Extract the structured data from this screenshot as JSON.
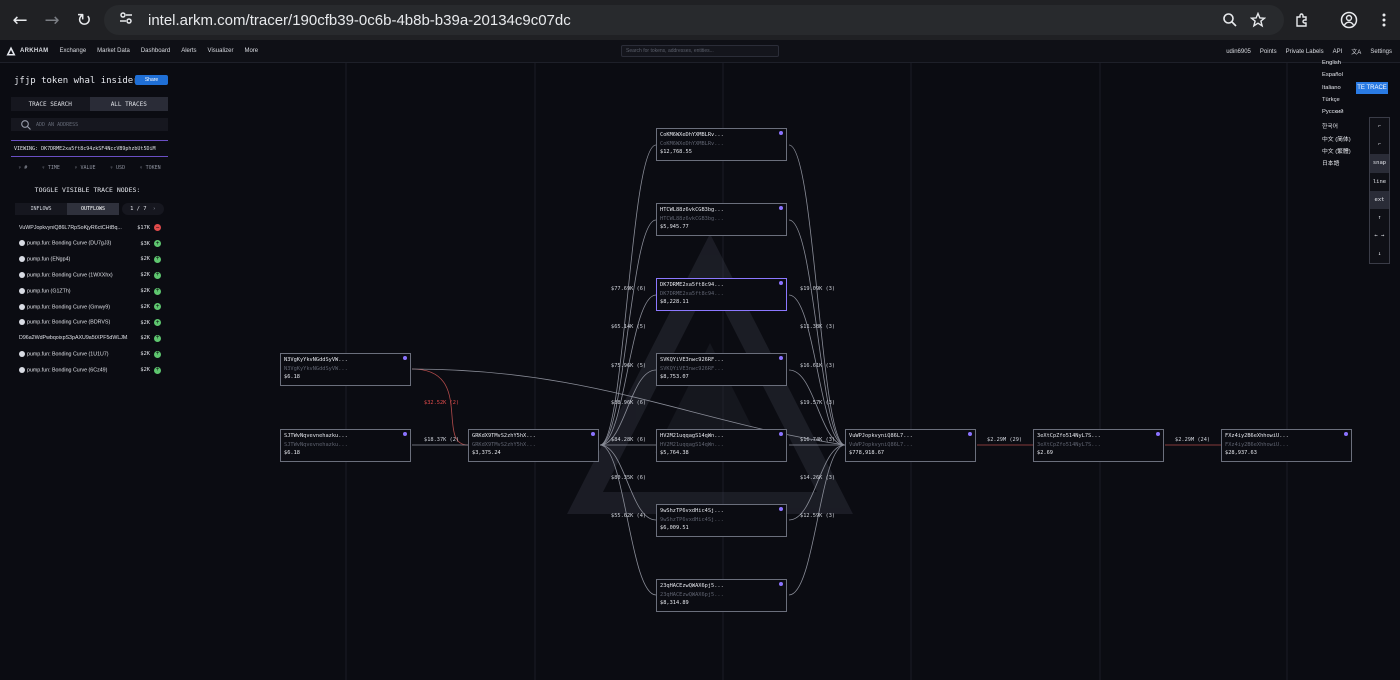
{
  "browser": {
    "url": "intel.arkm.com/tracer/190cfb39-0c6b-4b8b-b39a-20134c9c07dc"
  },
  "nav": {
    "brand": "ARKHAM",
    "links": [
      "Exchange",
      "Market Data",
      "Dashboard",
      "Alerts",
      "Visualizer",
      "More"
    ],
    "search_placeholder": "Search for tokens, addresses, entities...",
    "right": [
      "udin6905",
      "Points",
      "Private Labels",
      "API",
      "Settings"
    ]
  },
  "sidebar": {
    "title": "jfjp token whal insider",
    "share": "Share",
    "tab_search": "TRACE SEARCH",
    "tab_all": "ALL TRACES",
    "address_placeholder": "ADD AN ADDRESS",
    "viewing": "VIEWING: DK7DRME2xa5ft8c94zkSF4NccVB9phzbUt5DiM",
    "filters": [
      "#",
      "TIME",
      "VALUE",
      "USD",
      "TOKEN"
    ],
    "toggle_label": "TOGGLE VISIBLE TRACE NODES:",
    "inflows": "INFLOWS",
    "outflows": "OUTFLOWS",
    "pager": "1 / 7",
    "nodes": [
      {
        "label": "VuWPJopkvyniQ86L7RpSoKjyR6ctCHtBq...",
        "value": "$17K",
        "action": "remove",
        "dot": false
      },
      {
        "label": "pump.fun: Bonding Curve (DU7gJ3)",
        "value": "$3K",
        "action": "add",
        "dot": true
      },
      {
        "label": "pump.fun (ENgp4)",
        "value": "$2K",
        "action": "add",
        "dot": true
      },
      {
        "label": "pump.fun: Bonding Curve (1WXXhx)",
        "value": "$2K",
        "action": "add",
        "dot": true
      },
      {
        "label": "pump.fun (G1ZTh)",
        "value": "$2K",
        "action": "add",
        "dot": true
      },
      {
        "label": "pump.fun: Bonding Curve (Gmwy9)",
        "value": "$2K",
        "action": "add",
        "dot": true
      },
      {
        "label": "pump.fun: Bonding Curve (BDRVS)",
        "value": "$2K",
        "action": "add",
        "dot": true
      },
      {
        "label": "D96a2WdPwbqoixpS3pAXU9a5tXPF5dWLJM...",
        "value": "$2K",
        "action": "add",
        "dot": false
      },
      {
        "label": "pump.fun: Bonding Curve (1U1U7)",
        "value": "$2K",
        "action": "add",
        "dot": true
      },
      {
        "label": "pump.fun: Bonding Curve (6Cz49)",
        "value": "$2K",
        "action": "add",
        "dot": true
      }
    ]
  },
  "graph": {
    "nodes": [
      {
        "addr": "N3VgKyYkvNGddSyVW...",
        "sub": "N3VgKyYkvNGddSyVW...",
        "value": "$6.18"
      },
      {
        "addr": "SJTWvNqvevnehazku...",
        "sub": "SJTWvNqvevnehazku...",
        "value": "$6.18"
      },
      {
        "addr": "GRKdX9TMvS2zhY5hX...",
        "sub": "GRKdX9TMvS2zhY5hX...",
        "value": "$3,375.24"
      },
      {
        "addr": "CoKM6WXeDhYXMBLRv...",
        "sub": "CoKM6WXeDhYXMBLRv...",
        "value": "$12,768.55"
      },
      {
        "addr": "HTCWL88z6vkCGB3bg...",
        "sub": "HTCWL88z6vkCGB3bg...",
        "value": "$5,945.77"
      },
      {
        "addr": "DK7DRME2xa5ft8c94...",
        "sub": "DK7DRME2xa5ft8c94...",
        "value": "$8,228.11"
      },
      {
        "addr": "SVKQYiVE3nwc926RF...",
        "sub": "SVKQYiVE3nwc926RF...",
        "value": "$8,753.07"
      },
      {
        "addr": "HV2M21uqqagS14qWn...",
        "sub": "HV2M21uqqagS14qWn...",
        "value": "$5,764.38"
      },
      {
        "addr": "9wShzTP6vxdHic4Sj...",
        "sub": "9wShzTP6vxdHic4Sj...",
        "value": "$6,009.51"
      },
      {
        "addr": "23qHACEzwQWAX6pj5...",
        "sub": "23qHACEzwQWAX6pj5...",
        "value": "$8,314.89"
      },
      {
        "addr": "VuWPJopkvyniQ86L7...",
        "sub": "VuWPJopkvyniQ86L7...",
        "value": "$778,918.67"
      },
      {
        "addr": "3eXtCpZfo514NyL7S...",
        "sub": "3eXtCpZfo514NyL7S...",
        "value": "$2.69"
      },
      {
        "addr": "FXz4iy2B6eXhhowiU...",
        "sub": "FXz4iy2B6eXhhowiU...",
        "value": "$28,937.63"
      }
    ],
    "edges": {
      "n3v": "$32.52K (2)",
      "sjt": "$18.37K (2)",
      "l1": "$77.69K (6)",
      "l2": "$65.14K (5)",
      "l3": "$75.96K (5)",
      "l4": "$88.96K (6)",
      "l5a": "$84.28K (6)",
      "l5b": "$83.18K (6)",
      "l6": "$80.35K (6)",
      "l7": "$55.62K (4)",
      "r1": "$19.09K (3)",
      "r2": "$11.38K (3)",
      "r3": "$16.61K (3)",
      "r4": "$19.57K (3)",
      "r5": "$16.74K (3)",
      "r6": "$14.26K (3)",
      "r7": "$12.59K (3)",
      "v": "$2.29M (29)",
      "e": "$2.29M (24)"
    }
  },
  "languages": [
    "English",
    "Español",
    "Italiano",
    "Türkçe",
    "Русский",
    "한국어",
    "中文 (简体)",
    "中文 (繁體)",
    "日本語"
  ],
  "trace_button": "TE TRACE",
  "zoom_controls": [
    "⌐",
    "⌐",
    "snap",
    "line",
    "ext",
    "↑",
    "← →",
    "↓"
  ],
  "colors": {
    "accent": "#8c78ff",
    "share": "#1f6fd6",
    "edge_red": "#e14b4b",
    "remove": "#e14b4b",
    "add": "#5ec66f"
  }
}
